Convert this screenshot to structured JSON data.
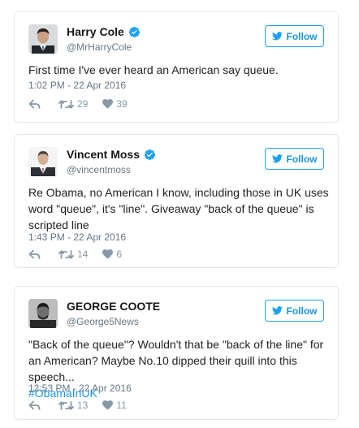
{
  "colors": {
    "accent": "#1da1f2",
    "link": "#1b95e0",
    "muted": "#657786",
    "border": "#e1e8ed",
    "icon": "#8899a6"
  },
  "tweets": [
    {
      "name": "Harry Cole",
      "handle": "@MrHarryCole",
      "verified": true,
      "follow_label": "Follow",
      "text": "First time I've ever heard an American say queue.",
      "timestamp": "1:02 PM - 22 Apr 2016",
      "retweets": "29",
      "likes": "39",
      "icons": {
        "reply": "reply-icon",
        "retweet": "retweet-icon",
        "like": "heart-icon",
        "follow": "twitter-bird-icon",
        "verified": "verified-badge-icon"
      }
    },
    {
      "name": "Vincent Moss",
      "handle": "@vincentmoss",
      "verified": true,
      "follow_label": "Follow",
      "text": "Re Obama, no American I know, including those in UK uses word \"queue\", it's \"line\". Giveaway \"back of the queue\" is scripted line",
      "timestamp": "1:43 PM - 22 Apr 2016",
      "retweets": "14",
      "likes": "6",
      "icons": {
        "reply": "reply-icon",
        "retweet": "retweet-icon",
        "like": "heart-icon",
        "follow": "twitter-bird-icon",
        "verified": "verified-badge-icon"
      }
    },
    {
      "name": "GEORGE COOTE",
      "handle": "@George5News",
      "verified": false,
      "follow_label": "Follow",
      "text": "\"Back of the queue\"? Wouldn't that be \"back of the line\" for an American? Maybe No.10 dipped their quill into this speech...",
      "hashtag": "#ObamaInUK",
      "timestamp": "12:53 PM - 22 Apr 2016",
      "retweets": "13",
      "likes": "11",
      "icons": {
        "reply": "reply-icon",
        "retweet": "retweet-icon",
        "like": "heart-icon",
        "follow": "twitter-bird-icon"
      }
    }
  ]
}
